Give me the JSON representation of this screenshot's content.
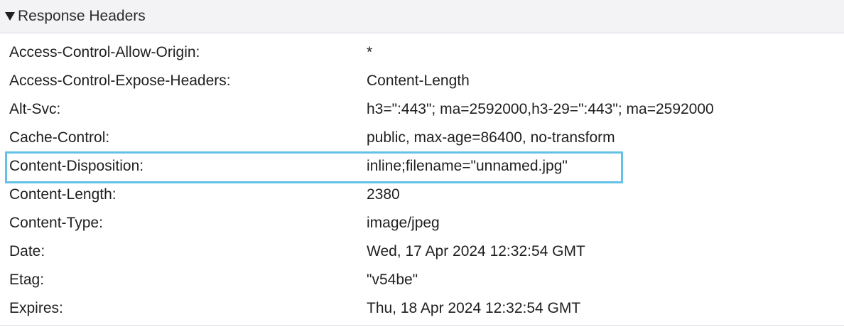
{
  "section": {
    "title": "Response Headers",
    "expanded": true,
    "toggle_icon": "triangle-down-icon"
  },
  "highlight_color": "#63c1e6",
  "headers": [
    {
      "name": "Access-Control-Allow-Origin:",
      "value": "*"
    },
    {
      "name": "Access-Control-Expose-Headers:",
      "value": "Content-Length"
    },
    {
      "name": "Alt-Svc:",
      "value": "h3=\":443\"; ma=2592000,h3-29=\":443\"; ma=2592000"
    },
    {
      "name": "Cache-Control:",
      "value": "public, max-age=86400, no-transform"
    },
    {
      "name": "Content-Disposition:",
      "value": "inline;filename=\"unnamed.jpg\"",
      "highlighted": true
    },
    {
      "name": "Content-Length:",
      "value": "2380"
    },
    {
      "name": "Content-Type:",
      "value": "image/jpeg"
    },
    {
      "name": "Date:",
      "value": "Wed, 17 Apr 2024 12:32:54 GMT"
    },
    {
      "name": "Etag:",
      "value": "\"v54be\""
    },
    {
      "name": "Expires:",
      "value": "Thu, 18 Apr 2024 12:32:54 GMT"
    }
  ]
}
